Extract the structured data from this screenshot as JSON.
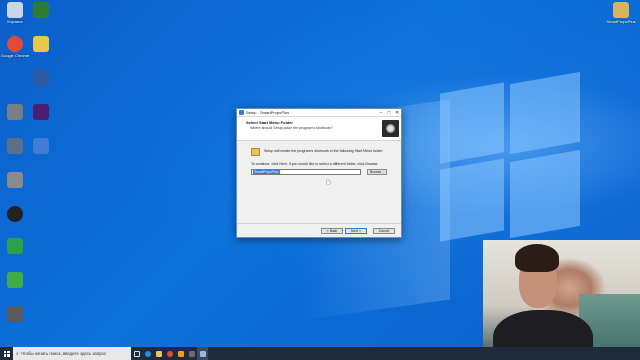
{
  "desktop": {
    "icons": [
      {
        "label": "Корзина",
        "color": "#c8d6e5"
      },
      {
        "label": "",
        "color": "#2f7d32"
      },
      {
        "label": "Google Chrome",
        "color": "#e04a3a"
      },
      {
        "label": "",
        "color": "#e7c84a"
      },
      {
        "label": "",
        "color": "#2c5aa0"
      },
      {
        "label": "",
        "color": "#7a7f86"
      },
      {
        "label": "",
        "color": "#4a1e6f"
      },
      {
        "label": "",
        "color": "#5d6f88"
      },
      {
        "label": "",
        "color": "#3d7dd8"
      },
      {
        "label": "",
        "color": "#8a8a8a"
      },
      {
        "label": "",
        "color": "#222222"
      },
      {
        "label": "",
        "color": "#2aa148"
      },
      {
        "label": "",
        "color": "#3fae49"
      },
      {
        "label": "",
        "color": "#5a5a5a"
      },
      {
        "label": "SmartPropoPlus",
        "color": "#d9b45a"
      }
    ]
  },
  "dialog": {
    "title": "Setup - SmartPropoPlus",
    "minimize": "–",
    "maximize": "□",
    "close": "✕",
    "header_title": "Select Start Menu Folder",
    "header_subtitle": "Where should Setup place the program's shortcuts?",
    "intro_text": "Setup will create the program's shortcuts in the following Start Menu folder.",
    "continue_text": "To continue, click Next. If you would like to select a different folder, click Browse.",
    "folder_value": "SmartPropoPlus",
    "browse_label": "Browse...",
    "back_label": "< Back",
    "next_label": "Next >",
    "cancel_label": "Cancel"
  },
  "taskbar": {
    "search_placeholder": "Чтобы начать поиск, введите здесь запрос"
  },
  "colors": {
    "desktop_blue": "#0a63c9",
    "taskbar": "#1f2a3a",
    "selection": "#3a78d4"
  }
}
